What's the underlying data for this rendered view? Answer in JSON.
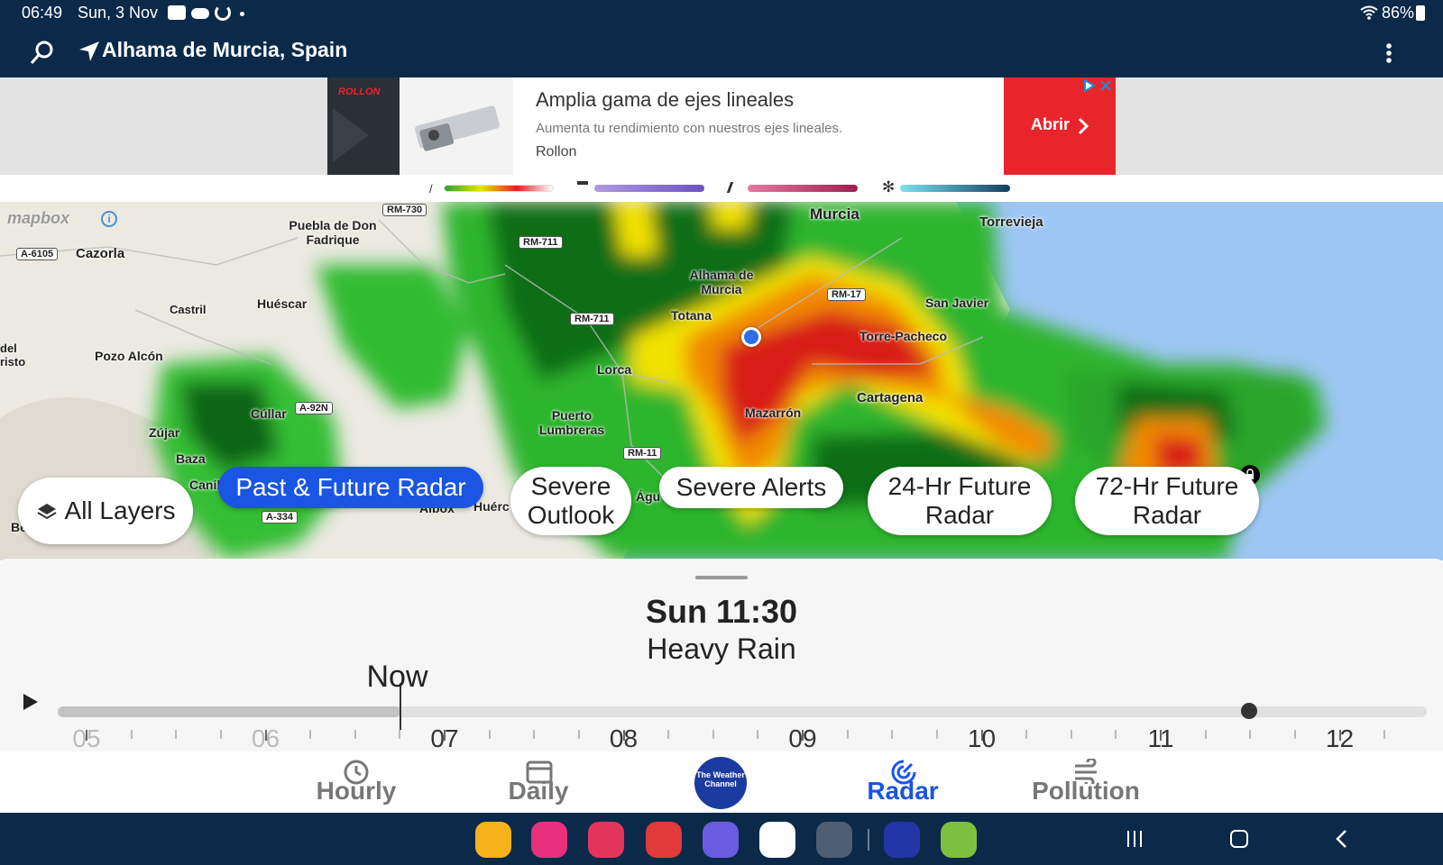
{
  "status": {
    "time": "06:49",
    "date": "Sun, 3 Nov",
    "battery": "86%"
  },
  "header": {
    "location": "Alhama de Murcia, Spain",
    "icons": [
      "search-icon",
      "navigation-arrow-icon",
      "more-vert-icon"
    ]
  },
  "ad": {
    "brand_logo_text": "ROLLON",
    "title": "Amplia gama de ejes lineales",
    "description": "Aumenta tu rendimiento con nuestros ejes lineales.",
    "advertiser": "Rollon",
    "cta": "Abrir",
    "cta_color": "#e8252a"
  },
  "legend": {
    "items": [
      {
        "icon": "rain-icon",
        "colors": [
          "#2aa52a",
          "#e6e600",
          "#e02020"
        ]
      },
      {
        "icon": "mix-icon",
        "colors": [
          "#b09ae0",
          "#7050c0"
        ]
      },
      {
        "icon": "sleet-icon",
        "colors": [
          "#e07aa0",
          "#a02050"
        ]
      },
      {
        "icon": "snow-icon",
        "colors": [
          "#7fe0f0",
          "#104060"
        ]
      }
    ]
  },
  "map": {
    "attribution": "mapbox",
    "places": [
      {
        "name": "Murcia"
      },
      {
        "name": "Torrevieja"
      },
      {
        "name": "Puebla de Don Fadrique"
      },
      {
        "name": "Cazorla"
      },
      {
        "name": "Huéscar"
      },
      {
        "name": "Castril"
      },
      {
        "name": "Pozo Alcón"
      },
      {
        "name": "del risto"
      },
      {
        "name": "Alhama de Murcia"
      },
      {
        "name": "San Javier"
      },
      {
        "name": "Totana"
      },
      {
        "name": "Torre-Pacheco"
      },
      {
        "name": "Lorca"
      },
      {
        "name": "Cartagena"
      },
      {
        "name": "Puerto Lumbreras"
      },
      {
        "name": "Mazarrón"
      },
      {
        "name": "Cúllar"
      },
      {
        "name": "Zújar"
      },
      {
        "name": "Baza"
      },
      {
        "name": "Canil"
      },
      {
        "name": "Albox"
      },
      {
        "name": "Huérc"
      },
      {
        "name": "Águ"
      },
      {
        "name": "Ben"
      }
    ],
    "roads": [
      "RM-730",
      "RM-711",
      "RM-711",
      "RM-17",
      "A-6105",
      "A-92N",
      "A-334",
      "RM-11"
    ]
  },
  "layers": {
    "all_layers": "All Layers",
    "chips": [
      {
        "label": "Past & Future Radar",
        "active": true
      },
      {
        "label": "Severe Outlook",
        "active": false
      },
      {
        "label": "Severe Alerts",
        "active": false
      },
      {
        "label": "24-Hr Future Radar",
        "active": false
      },
      {
        "label": "72-Hr Future Radar",
        "active": false
      }
    ]
  },
  "timeline": {
    "time": "Sun 11:30",
    "condition": "Heavy Rain",
    "now_label": "Now",
    "now_fraction": 0.25,
    "current_fraction": 0.87,
    "hours": [
      "05",
      "06",
      "07",
      "08",
      "09",
      "10",
      "11",
      "12"
    ]
  },
  "nav": {
    "items": [
      {
        "label": "Hourly",
        "icon": "clock-icon",
        "active": false
      },
      {
        "label": "Daily",
        "icon": "calendar-icon",
        "active": false
      },
      {
        "label": "The Weather Channel",
        "icon": "twc-logo",
        "active": false
      },
      {
        "label": "Radar",
        "icon": "radar-icon",
        "active": true
      },
      {
        "label": "Pollution",
        "icon": "wind-icon",
        "active": false
      }
    ],
    "active_color": "#1a55e3"
  },
  "dock": {
    "apps": [
      "files-icon",
      "flower-icon",
      "camera-icon",
      "mail-icon",
      "chat-icon",
      "weather-cloud-icon",
      "app-grid-icon",
      "m-app-icon",
      "leaf-app-icon"
    ]
  }
}
